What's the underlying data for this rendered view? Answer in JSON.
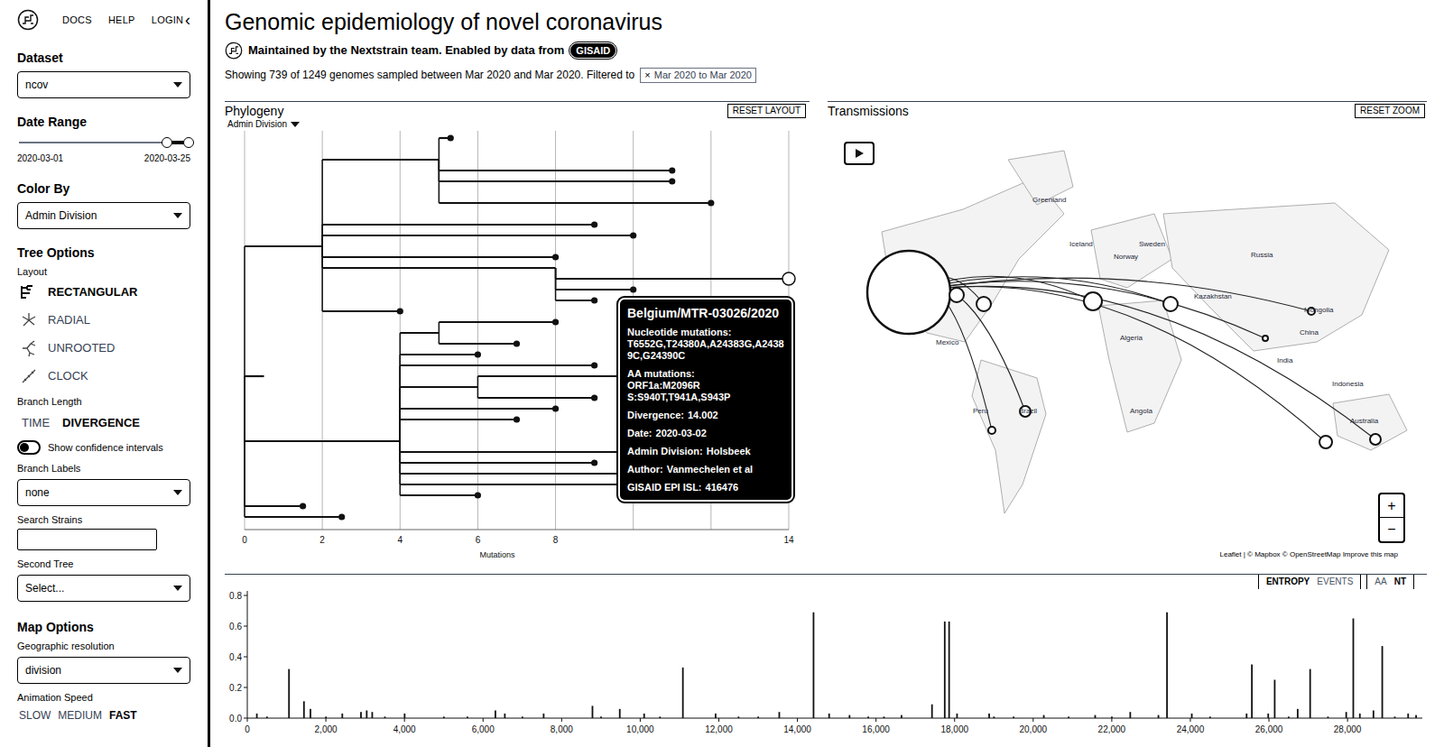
{
  "header": {
    "nav": [
      "DOCS",
      "HELP",
      "LOGIN"
    ],
    "collapse": "‹"
  },
  "sidebar": {
    "dataset": {
      "label": "Dataset",
      "value": "ncov"
    },
    "date_range": {
      "label": "Date Range",
      "start": "2020-03-01",
      "end": "2020-03-25",
      "low": 0.87,
      "high": 1.0
    },
    "color_by": {
      "label": "Color By",
      "value": "Admin Division"
    },
    "tree_options": {
      "title": "Tree Options",
      "layout_label": "Layout",
      "layouts": [
        {
          "label": "RECTANGULAR",
          "selected": true
        },
        {
          "label": "RADIAL",
          "selected": false
        },
        {
          "label": "UNROOTED",
          "selected": false
        },
        {
          "label": "CLOCK",
          "selected": false
        }
      ]
    },
    "branch_length": {
      "label": "Branch Length",
      "options": [
        {
          "label": "TIME",
          "selected": false
        },
        {
          "label": "DIVERGENCE",
          "selected": true
        }
      ]
    },
    "confidence": {
      "label": "Show confidence intervals",
      "on": false
    },
    "branch_labels": {
      "label": "Branch Labels",
      "value": "none"
    },
    "search": {
      "label": "Search Strains",
      "value": ""
    },
    "second_tree": {
      "label": "Second Tree",
      "value": "Select..."
    },
    "map_options": {
      "title": "Map Options",
      "resolution_label": "Geographic resolution",
      "resolution": "division"
    },
    "animation": {
      "label": "Animation Speed",
      "options": [
        {
          "label": "SLOW",
          "selected": false
        },
        {
          "label": "MEDIUM",
          "selected": false
        },
        {
          "label": "FAST",
          "selected": true
        }
      ]
    }
  },
  "title": "Genomic epidemiology of novel coronavirus",
  "byline": {
    "text": "Maintained by the Nextstrain team. Enabled by data from",
    "source": "GISAID"
  },
  "summary": {
    "text": "Showing 739 of 1249 genomes sampled between Mar 2020 and Mar 2020. Filtered to",
    "filter_close": "×",
    "filter": "Mar 2020 to Mar 2020"
  },
  "phylogeny": {
    "title": "Phylogeny",
    "reset": "RESET LAYOUT",
    "color_menu": "Admin Division",
    "axis_label": "Mutations",
    "ticks": [
      {
        "value": 0,
        "label": "0"
      },
      {
        "value": 2,
        "label": "2"
      },
      {
        "value": 4,
        "label": "4"
      },
      {
        "value": 6,
        "label": "6"
      },
      {
        "value": 8,
        "label": "8"
      },
      {
        "value": 14,
        "label": "14"
      }
    ],
    "branches": [
      {
        "from": 0,
        "to": 2,
        "row": 10,
        "parent": 22,
        "tip": false,
        "selected": false
      },
      {
        "from": 0,
        "to": 4,
        "row": 28,
        "parent": 22,
        "tip": false,
        "selected": false
      },
      {
        "from": 0,
        "to": 2.5,
        "row": 35,
        "parent": 22,
        "tip": true,
        "selected": false
      },
      {
        "from": 0,
        "to": 0.5,
        "row": 22,
        "parent": 22,
        "tip": false,
        "selected": false
      },
      {
        "from": 2,
        "to": 5,
        "row": 2,
        "parent": 10,
        "tip": false,
        "selected": false
      },
      {
        "from": 5,
        "to": 5.3,
        "row": 0,
        "parent": 2,
        "tip": true,
        "selected": false
      },
      {
        "from": 5,
        "to": 11,
        "row": 3,
        "parent": 2,
        "tip": true,
        "selected": false
      },
      {
        "from": 5,
        "to": 11,
        "row": 4,
        "parent": 2,
        "tip": true,
        "selected": false
      },
      {
        "from": 5,
        "to": 12,
        "row": 6,
        "parent": 2,
        "tip": true,
        "selected": false
      },
      {
        "from": 2,
        "to": 9,
        "row": 8,
        "parent": 10,
        "tip": true,
        "selected": false
      },
      {
        "from": 2,
        "to": 10,
        "row": 9,
        "parent": 10,
        "tip": true,
        "selected": false
      },
      {
        "from": 2,
        "to": 8,
        "row": 11,
        "parent": 10,
        "tip": true,
        "selected": false
      },
      {
        "from": 2,
        "to": 8,
        "row": 12,
        "parent": 10,
        "tip": false,
        "selected": false
      },
      {
        "from": 8,
        "to": 14,
        "row": 13,
        "parent": 12,
        "tip": true,
        "selected": true
      },
      {
        "from": 8,
        "to": 10,
        "row": 14,
        "parent": 12,
        "tip": true,
        "selected": false
      },
      {
        "from": 8,
        "to": 9,
        "row": 15,
        "parent": 12,
        "tip": true,
        "selected": false
      },
      {
        "from": 2,
        "to": 4,
        "row": 16,
        "parent": 10,
        "tip": true,
        "selected": false
      },
      {
        "from": 4,
        "to": 5,
        "row": 18,
        "parent": 28,
        "tip": false,
        "selected": false
      },
      {
        "from": 5,
        "to": 8,
        "row": 17,
        "parent": 18,
        "tip": true,
        "selected": false
      },
      {
        "from": 5,
        "to": 7,
        "row": 19,
        "parent": 18,
        "tip": true,
        "selected": false
      },
      {
        "from": 4,
        "to": 6,
        "row": 20,
        "parent": 28,
        "tip": true,
        "selected": false
      },
      {
        "from": 4,
        "to": 9,
        "row": 21,
        "parent": 28,
        "tip": true,
        "selected": false
      },
      {
        "from": 4,
        "to": 6,
        "row": 23,
        "parent": 28,
        "tip": false,
        "selected": false
      },
      {
        "from": 6,
        "to": 10,
        "row": 22,
        "parent": 23,
        "tip": true,
        "selected": false
      },
      {
        "from": 6,
        "to": 9,
        "row": 24,
        "parent": 23,
        "tip": true,
        "selected": false
      },
      {
        "from": 4,
        "to": 8,
        "row": 25,
        "parent": 28,
        "tip": true,
        "selected": false
      },
      {
        "from": 4,
        "to": 7,
        "row": 26,
        "parent": 28,
        "tip": true,
        "selected": false
      },
      {
        "from": 4,
        "to": 10,
        "row": 29,
        "parent": 28,
        "tip": true,
        "selected": false
      },
      {
        "from": 4,
        "to": 9,
        "row": 30,
        "parent": 28,
        "tip": true,
        "selected": false
      },
      {
        "from": 4,
        "to": 12,
        "row": 31,
        "parent": 28,
        "tip": true,
        "selected": false
      },
      {
        "from": 4,
        "to": 12,
        "row": 32,
        "parent": 28,
        "tip": true,
        "selected": false
      },
      {
        "from": 4,
        "to": 6,
        "row": 33,
        "parent": 28,
        "tip": true,
        "selected": false
      },
      {
        "from": 0,
        "to": 1.5,
        "row": 34,
        "parent": 22,
        "tip": true,
        "selected": false
      }
    ],
    "tooltip": {
      "strain": "Belgium/MTR-03026/2020",
      "fields": [
        {
          "kind": "block",
          "label": "Nucleotide mutations:",
          "values": [
            "T6552G,T24380A,A24383G,A24389C,G24390C"
          ]
        },
        {
          "kind": "block",
          "label": "AA mutations:",
          "values": [
            "ORF1a:M2096R",
            "S:S940T,T941A,S943P"
          ]
        },
        {
          "kind": "inline",
          "label": "Divergence:",
          "values": [
            "14.002"
          ]
        },
        {
          "kind": "inline",
          "label": "Date:",
          "values": [
            "2020-03-02"
          ]
        },
        {
          "kind": "inline",
          "label": "Admin Division:",
          "values": [
            "Holsbeek"
          ]
        },
        {
          "kind": "inline",
          "label": "Author:",
          "values": [
            "Vanmechelen et al"
          ]
        },
        {
          "kind": "inline",
          "label": "GISAID EPI ISL:",
          "values": [
            "416476"
          ]
        }
      ]
    }
  },
  "map": {
    "title": "Transmissions",
    "reset": "RESET ZOOM",
    "zoom_in": "+",
    "zoom_out": "−",
    "attribution": "Leaflet | © Mapbox © OpenStreetMap Improve this map",
    "labels": [
      "Greenland",
      "Iceland",
      "Norway",
      "Sweden",
      "Russia",
      "Kazakhstan",
      "Mongolia",
      "China",
      "India",
      "Mexico",
      "Peru",
      "Brazil",
      "Algeria",
      "Angola",
      "Indonesia",
      "Australia"
    ]
  },
  "entropy": {
    "tabs": [
      {
        "label": "ENTROPY",
        "selected": true
      },
      {
        "label": "EVENTS",
        "selected": false
      }
    ],
    "modes": [
      {
        "label": "AA",
        "selected": false
      },
      {
        "label": "NT",
        "selected": true
      }
    ],
    "y_ticks": [
      {
        "value": 0,
        "label": "0.0"
      },
      {
        "value": 0.2,
        "label": "0.2"
      },
      {
        "value": 0.4,
        "label": "0.4"
      },
      {
        "value": 0.6,
        "label": "0.6"
      },
      {
        "value": 0.8,
        "label": "0.8"
      }
    ],
    "x_ticks": [
      {
        "value": 0,
        "label": "0"
      },
      {
        "value": 2000,
        "label": "2,000"
      },
      {
        "value": 4000,
        "label": "4,000"
      },
      {
        "value": 6000,
        "label": "6,000"
      },
      {
        "value": 8000,
        "label": "8,000"
      },
      {
        "value": 10000,
        "label": "10,000"
      },
      {
        "value": 12000,
        "label": "12,000"
      },
      {
        "value": 14000,
        "label": "14,000"
      },
      {
        "value": 16000,
        "label": "16,000"
      },
      {
        "value": 18000,
        "label": "18,000"
      },
      {
        "value": 20000,
        "label": "20,000"
      },
      {
        "value": 22000,
        "label": "22,000"
      },
      {
        "value": 24000,
        "label": "24,000"
      },
      {
        "value": 26000,
        "label": "26,000"
      },
      {
        "value": 28000,
        "label": "28,000"
      }
    ],
    "bars": [
      {
        "position": 1059,
        "entropy": 0.32
      },
      {
        "position": 11083,
        "entropy": 0.33
      },
      {
        "position": 14408,
        "entropy": 0.69
      },
      {
        "position": 17747,
        "entropy": 0.63
      },
      {
        "position": 17858,
        "entropy": 0.63
      },
      {
        "position": 23403,
        "entropy": 0.69
      },
      {
        "position": 25563,
        "entropy": 0.35
      },
      {
        "position": 26144,
        "entropy": 0.25
      },
      {
        "position": 27046,
        "entropy": 0.32
      },
      {
        "position": 28144,
        "entropy": 0.65
      },
      {
        "position": 28881,
        "entropy": 0.47
      },
      {
        "position": 241,
        "entropy": 0.03
      },
      {
        "position": 1440,
        "entropy": 0.11
      },
      {
        "position": 1605,
        "entropy": 0.06
      },
      {
        "position": 2416,
        "entropy": 0.03
      },
      {
        "position": 2891,
        "entropy": 0.04
      },
      {
        "position": 3037,
        "entropy": 0.05
      },
      {
        "position": 3177,
        "entropy": 0.04
      },
      {
        "position": 4002,
        "entropy": 0.03
      },
      {
        "position": 6312,
        "entropy": 0.05
      },
      {
        "position": 6552,
        "entropy": 0.03
      },
      {
        "position": 7540,
        "entropy": 0.03
      },
      {
        "position": 8782,
        "entropy": 0.08
      },
      {
        "position": 9477,
        "entropy": 0.06
      },
      {
        "position": 10097,
        "entropy": 0.03
      },
      {
        "position": 11916,
        "entropy": 0.03
      },
      {
        "position": 13536,
        "entropy": 0.04
      },
      {
        "position": 14805,
        "entropy": 0.03
      },
      {
        "position": 15324,
        "entropy": 0.02
      },
      {
        "position": 16647,
        "entropy": 0.02
      },
      {
        "position": 17423,
        "entropy": 0.09
      },
      {
        "position": 18060,
        "entropy": 0.03
      },
      {
        "position": 18877,
        "entropy": 0.03
      },
      {
        "position": 20268,
        "entropy": 0.02
      },
      {
        "position": 21575,
        "entropy": 0.02
      },
      {
        "position": 22468,
        "entropy": 0.04
      },
      {
        "position": 23185,
        "entropy": 0.02
      },
      {
        "position": 24034,
        "entropy": 0.03
      },
      {
        "position": 25429,
        "entropy": 0.03
      },
      {
        "position": 25979,
        "entropy": 0.03
      },
      {
        "position": 26729,
        "entropy": 0.06
      },
      {
        "position": 27964,
        "entropy": 0.04
      },
      {
        "position": 28311,
        "entropy": 0.03
      },
      {
        "position": 28657,
        "entropy": 0.05
      },
      {
        "position": 29540,
        "entropy": 0.03
      },
      {
        "position": 29742,
        "entropy": 0.02
      },
      {
        "position": 500,
        "entropy": 0.01
      },
      {
        "position": 2000,
        "entropy": 0.01
      },
      {
        "position": 3500,
        "entropy": 0.01
      },
      {
        "position": 5000,
        "entropy": 0.01
      },
      {
        "position": 5600,
        "entropy": 0.01
      },
      {
        "position": 7000,
        "entropy": 0.01
      },
      {
        "position": 9000,
        "entropy": 0.01
      },
      {
        "position": 10500,
        "entropy": 0.01
      },
      {
        "position": 12500,
        "entropy": 0.01
      },
      {
        "position": 13000,
        "entropy": 0.01
      },
      {
        "position": 15800,
        "entropy": 0.01
      },
      {
        "position": 16200,
        "entropy": 0.01
      },
      {
        "position": 19000,
        "entropy": 0.01
      },
      {
        "position": 19500,
        "entropy": 0.01
      },
      {
        "position": 20900,
        "entropy": 0.01
      },
      {
        "position": 22000,
        "entropy": 0.01
      },
      {
        "position": 24500,
        "entropy": 0.01
      },
      {
        "position": 26500,
        "entropy": 0.01
      },
      {
        "position": 27500,
        "entropy": 0.01
      },
      {
        "position": 29200,
        "entropy": 0.01
      }
    ]
  }
}
